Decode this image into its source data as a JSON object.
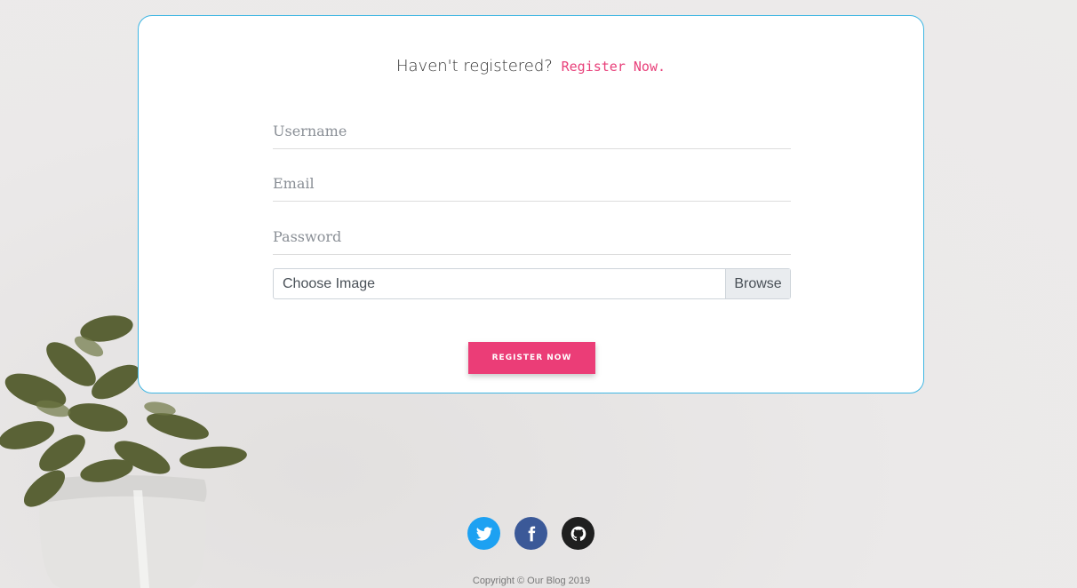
{
  "signup": {
    "prompt": "Haven't registered?",
    "link_text": "Register Now."
  },
  "form": {
    "username_placeholder": "Username",
    "email_placeholder": "Email",
    "password_placeholder": "Password",
    "file_label": "Choose Image",
    "browse_label": "Browse",
    "submit_label": "REGISTER NOW"
  },
  "social": {
    "twitter_icon": "twitter-icon",
    "facebook_icon": "facebook-icon",
    "github_icon": "github-icon"
  },
  "footer": {
    "copyright": "Copyright © Our Blog 2019"
  },
  "colors": {
    "accent": "#eb3d77",
    "card_border": "#3fb6e3",
    "twitter": "#1da1f2",
    "facebook": "#3b5998",
    "github": "#1f1f1f"
  }
}
